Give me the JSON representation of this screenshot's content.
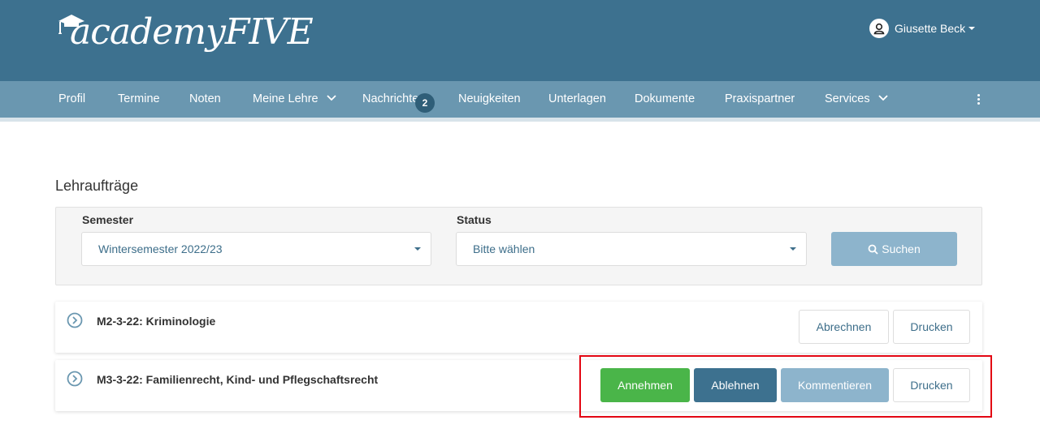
{
  "header": {
    "logo_text": "academyFIVE",
    "user_name": "Giusette Beck"
  },
  "nav": {
    "items": [
      {
        "label": "Profil"
      },
      {
        "label": "Termine"
      },
      {
        "label": "Noten"
      },
      {
        "label": "Meine Lehre"
      },
      {
        "label": "Nachrichten"
      },
      {
        "label": "Neuigkeiten"
      },
      {
        "label": "Unterlagen"
      },
      {
        "label": "Dokumente"
      },
      {
        "label": "Praxispartner"
      },
      {
        "label": "Services"
      }
    ],
    "messages_badge": "2"
  },
  "page": {
    "title": "Lehraufträge"
  },
  "filters": {
    "semester_label": "Semester",
    "semester_value": "Wintersemester 2022/23",
    "status_label": "Status",
    "status_value": "Bitte wählen",
    "search_label": "Suchen"
  },
  "rows": [
    {
      "title": "M2-3-22: Kriminologie",
      "actions": {
        "abrechnen": "Abrechnen",
        "drucken": "Drucken"
      }
    },
    {
      "title": "M3-3-22: Familienrecht, Kind- und Pflegschaftsrecht",
      "actions": {
        "annehmen": "Annehmen",
        "ablehnen": "Ablehnen",
        "kommentieren": "Kommentieren",
        "drucken": "Drucken"
      }
    }
  ],
  "colors": {
    "header_bg": "#3d718f",
    "nav_bg": "#6a97b0",
    "accept_green": "#4ab549",
    "highlight_red": "#e30613"
  }
}
